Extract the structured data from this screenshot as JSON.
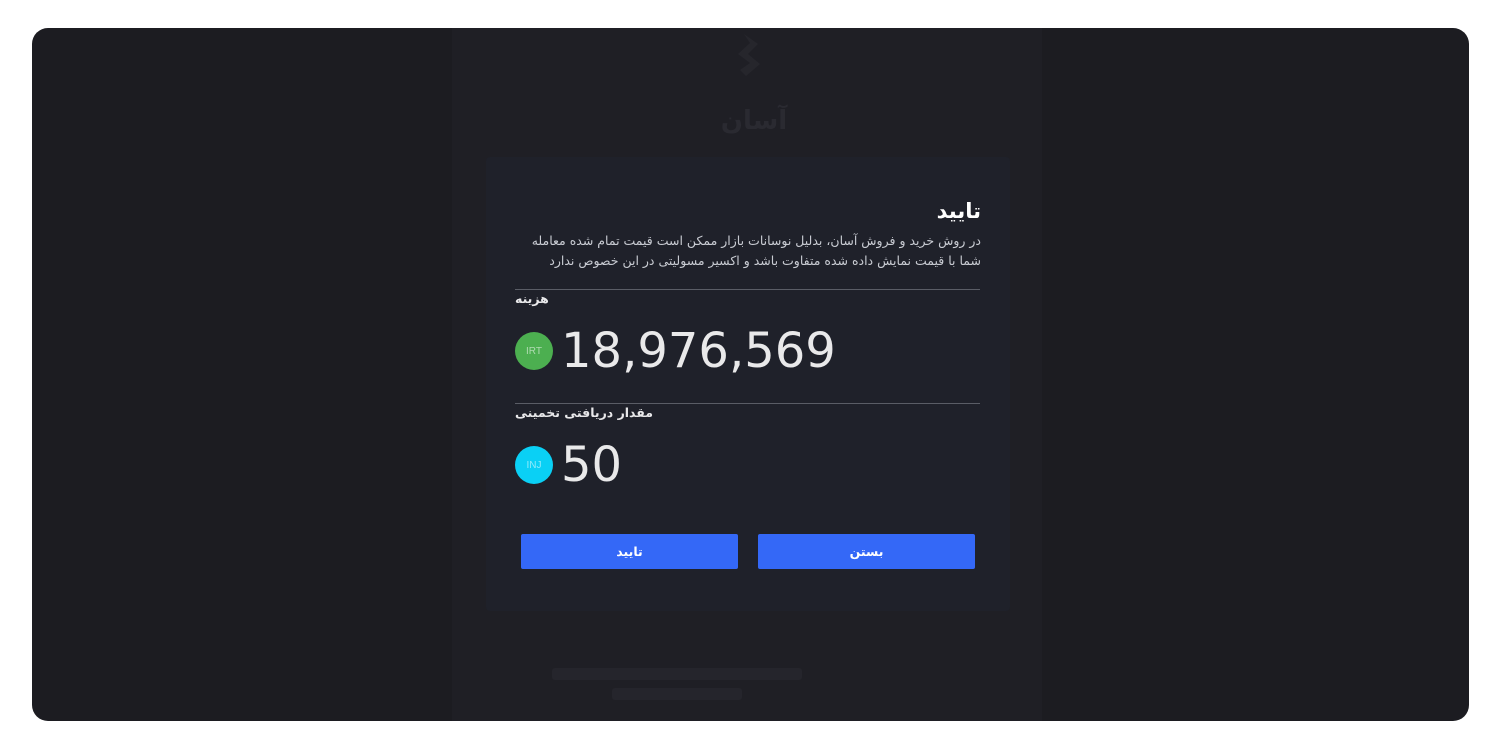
{
  "dialog": {
    "title": "تایید",
    "description": "در روش خرید و فروش آسان، بدلیل نوسانات بازار ممکن است قیمت تمام شده معامله شما با قیمت نمایش داده شده متفاوت باشد و اکسیر مسولیتی در این خصوص ندارد",
    "cost_label": "هزینه",
    "cost_value": "18,976,569",
    "cost_currency": "IRT",
    "cost_currency_color": "#4caf50",
    "receive_label": "مقدار دریافتی تخمینی",
    "receive_value": "50",
    "receive_currency": "INJ",
    "receive_currency_color": "#0ad0f5",
    "confirm_button": "تایید",
    "close_button": "بستن"
  },
  "background": {
    "title": "آسان"
  },
  "colors": {
    "overlay": "#1c1c21",
    "dialog": "#1f212a",
    "accent": "#3468f7"
  }
}
